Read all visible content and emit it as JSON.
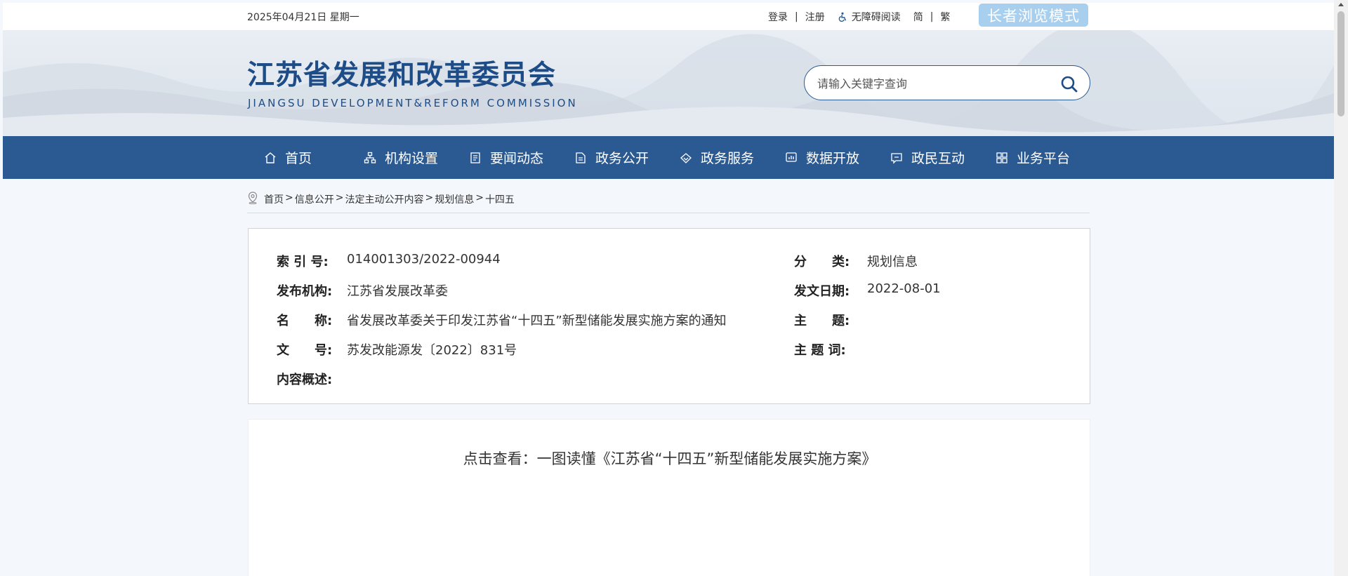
{
  "topbar": {
    "date": "2025年04月21日 星期一",
    "login": "登录",
    "register": "注册",
    "accessible": "无障碍阅读",
    "simplified": "简",
    "traditional": "繁",
    "elder_mode": "长者浏览模式",
    "sep": "|"
  },
  "header": {
    "title": "江苏省发展和改革委员会",
    "subtitle": "JIANGSU DEVELOPMENT&REFORM COMMISSION"
  },
  "search": {
    "placeholder": "请输入关键字查询"
  },
  "nav": {
    "items": [
      {
        "label": "首页",
        "icon": "home-icon"
      },
      {
        "label": "机构设置",
        "icon": "org-chart-icon"
      },
      {
        "label": "要闻动态",
        "icon": "news-icon"
      },
      {
        "label": "政务公开",
        "icon": "document-icon"
      },
      {
        "label": "政务服务",
        "icon": "service-icon"
      },
      {
        "label": "数据开放",
        "icon": "data-icon"
      },
      {
        "label": "政民互动",
        "icon": "chat-icon"
      },
      {
        "label": "业务平台",
        "icon": "grid-icon"
      }
    ]
  },
  "breadcrumb": {
    "items": [
      "首页",
      "信息公开",
      "法定主动公开内容",
      "规划信息",
      "十四五"
    ],
    "sep": ">"
  },
  "info": {
    "index_label": "索 引 号:",
    "index_value": "014001303/2022-00944",
    "category_label": "分　　类:",
    "category_value": "规划信息",
    "publisher_label": "发布机构:",
    "publisher_value": "江苏省发展改革委",
    "date_label": "发文日期:",
    "date_value": "2022-08-01",
    "name_label": "名　　称:",
    "name_value": "省发展改革委关于印发江苏省“十四五”新型储能发展实施方案的通知",
    "subject_label": "主　　题:",
    "subject_value": "",
    "docno_label": "文　　号:",
    "docno_value": "苏发改能源发〔2022〕831号",
    "keywords_label": "主 题 词:",
    "keywords_value": "",
    "summary_label": "内容概述:",
    "summary_value": ""
  },
  "content": {
    "link": "点击查看：一图读懂《江苏省“十四五”新型储能发展实施方案》"
  },
  "colors": {
    "brand": "#2b5a93",
    "elder_button": "#a9cfee",
    "page_bg": "#f4f7fb"
  }
}
